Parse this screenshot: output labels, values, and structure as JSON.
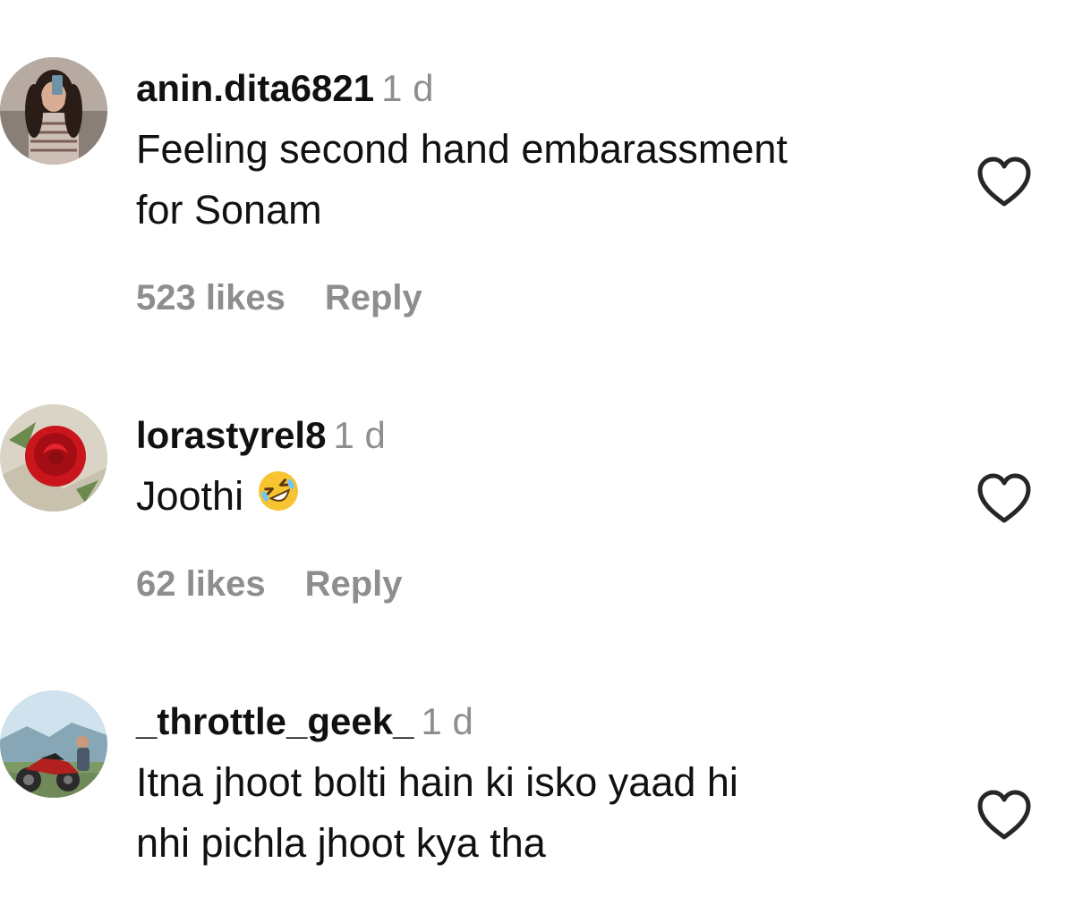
{
  "comments": [
    {
      "username": "anin.dita6821",
      "time": "1 d",
      "text_lines": [
        "Feeling second hand embarassment",
        "for Sonam"
      ],
      "likes": "523 likes",
      "reply": "Reply"
    },
    {
      "username": "lorastyrel8",
      "time": "1 d",
      "text_lines": [
        "Joothi"
      ],
      "emoji": "rolling-on-floor-laughing-emoji",
      "likes": "62 likes",
      "reply": "Reply"
    },
    {
      "username": "_throttle_geek_",
      "time": "1 d",
      "text_lines": [
        "Itna jhoot bolti hain ki isko yaad hi",
        "nhi pichla jhoot kya tha"
      ]
    }
  ],
  "icons": {
    "like": "heart-outline-icon"
  },
  "colors": {
    "text": "#111111",
    "secondary": "#8e8e8e",
    "background": "#ffffff"
  }
}
